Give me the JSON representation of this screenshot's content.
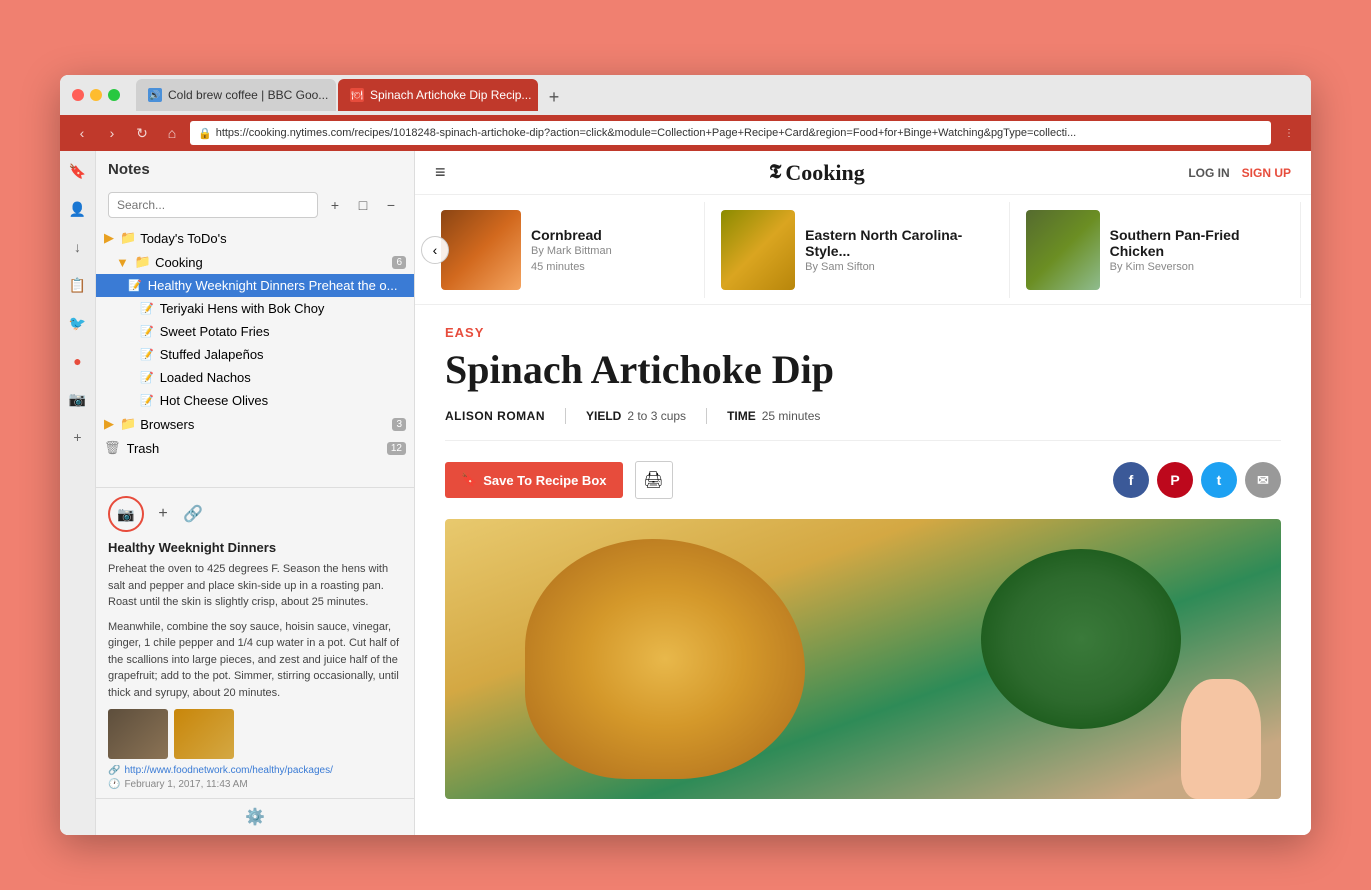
{
  "window": {
    "background": "#f08070"
  },
  "browser": {
    "tabs": [
      {
        "id": "tab1",
        "label": "Cold brew coffee | BBC Goo...",
        "active": false,
        "favicon_color": "#4a90d9"
      },
      {
        "id": "tab2",
        "label": "Spinach Artichoke Dip Recip...",
        "active": true,
        "favicon_color": "#e74c3c"
      }
    ],
    "new_tab_label": "+",
    "address": "https://cooking.nytimes.com/recipes/1018248-spinach-artichoke-dip?action=click&module=Collection+Page+Recipe+Card&region=Food+for+Binge+Watching&pgType=collecti...",
    "back_label": "‹",
    "forward_label": "›",
    "reload_label": "↻",
    "home_label": "⌂",
    "lock_label": "🔒"
  },
  "notes": {
    "title": "Notes",
    "search_placeholder": "Search...",
    "add_label": "+",
    "folder_label": "□",
    "minus_label": "−",
    "tree": [
      {
        "id": "today",
        "label": "Today's ToDo's",
        "type": "folder",
        "indent": 0,
        "badge": ""
      },
      {
        "id": "cooking",
        "label": "Cooking",
        "type": "folder",
        "indent": 0,
        "badge": "6"
      },
      {
        "id": "weeknight",
        "label": "Healthy Weeknight Dinners Preheat the o...",
        "type": "note",
        "indent": 2,
        "selected": true,
        "badge": ""
      },
      {
        "id": "teriyaki",
        "label": "Teriyaki Hens with Bok Choy",
        "type": "note",
        "indent": 3,
        "badge": ""
      },
      {
        "id": "sweetpotato",
        "label": "Sweet Potato Fries",
        "type": "note",
        "indent": 3,
        "badge": ""
      },
      {
        "id": "jalapenos",
        "label": "Stuffed Jalapeños",
        "type": "note",
        "indent": 3,
        "badge": ""
      },
      {
        "id": "nachos",
        "label": "Loaded Nachos",
        "type": "note",
        "indent": 3,
        "badge": ""
      },
      {
        "id": "cheeses",
        "label": "Hot Cheese Olives",
        "type": "note",
        "indent": 3,
        "badge": ""
      },
      {
        "id": "browsers",
        "label": "Browsers",
        "type": "folder",
        "indent": 0,
        "badge": "3"
      },
      {
        "id": "trash",
        "label": "Trash",
        "type": "folder",
        "indent": 0,
        "badge": "12"
      }
    ],
    "preview": {
      "title": "Healthy Weeknight Dinners",
      "text1": "Preheat the oven to 425 degrees F. Season the hens with salt and pepper and place skin-side up in a roasting pan. Roast until the skin is slightly crisp, about 25 minutes.",
      "text2": "Meanwhile, combine the soy sauce, hoisin sauce, vinegar, ginger, 1 chile pepper and 1/4 cup water in a pot. Cut half of the scallions into large pieces, and zest and juice half of the grapefruit; add to the pot. Simmer, stirring occasionally, until thick and syrupy, about 20 minutes.",
      "link": "http://www.foodnetwork.com/healthy/packages/",
      "date": "February 1, 2017, 11:43 AM"
    },
    "sidebar_icons": [
      "☰",
      "👤",
      "↓",
      "📋",
      "🐦",
      "●",
      "📷",
      "+"
    ],
    "settings_icon": "⚙"
  },
  "cooking": {
    "header": {
      "hamburger": "≡",
      "logo": "Cooking",
      "nyt_t": "𝕿",
      "log_in": "LOG IN",
      "sign_up": "SIGN UP"
    },
    "recipe_cards": [
      {
        "id": "cornbread",
        "title": "Cornbread",
        "author": "By Mark Bittman",
        "time": "45 minutes"
      },
      {
        "id": "eastern",
        "title": "Eastern North Carolina-Style...",
        "author": "By Sam Sifton",
        "time": ""
      },
      {
        "id": "southern",
        "title": "Southern Pan-Fried Chicken",
        "author": "By Kim Severson",
        "time": ""
      }
    ],
    "recipe": {
      "tag": "EASY",
      "title": "Spinach Artichoke Dip",
      "author": "ALISON ROMAN",
      "yield_label": "YIELD",
      "yield_value": "2 to 3 cups",
      "time_label": "TIME",
      "time_value": "25 minutes",
      "save_btn": "Save To Recipe Box",
      "print_icon": "🖨",
      "social": {
        "facebook": "f",
        "pinterest": "P",
        "twitter": "t",
        "email": "✉"
      }
    }
  }
}
